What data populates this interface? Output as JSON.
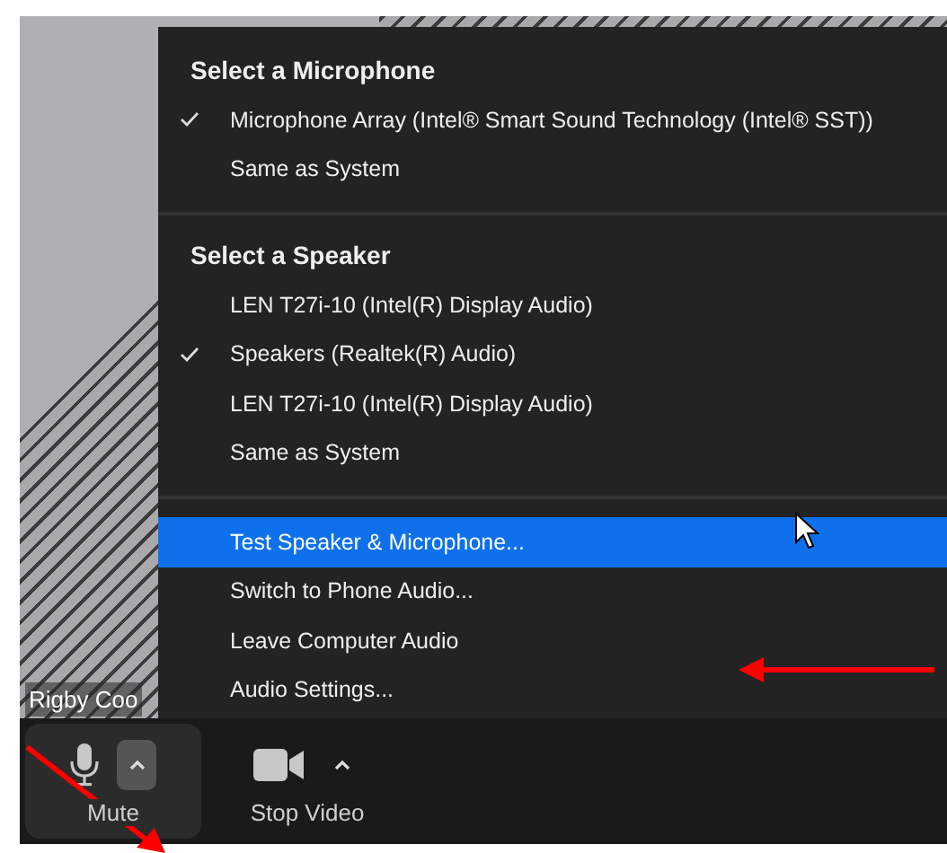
{
  "video": {
    "participant_name": "Rigby Coo"
  },
  "menu": {
    "sections": [
      {
        "heading": "Select a Microphone",
        "items": [
          {
            "label": "Microphone Array (Intel® Smart Sound Technology (Intel® SST))",
            "checked": true
          },
          {
            "label": "Same as System",
            "checked": false
          }
        ]
      },
      {
        "heading": "Select a Speaker",
        "items": [
          {
            "label": "LEN T27i-10 (Intel(R) Display Audio)",
            "checked": false
          },
          {
            "label": "Speakers (Realtek(R) Audio)",
            "checked": true
          },
          {
            "label": "LEN T27i-10 (Intel(R) Display Audio)",
            "checked": false
          },
          {
            "label": "Same as System",
            "checked": false
          }
        ]
      }
    ],
    "actions": [
      {
        "label": "Test Speaker & Microphone...",
        "selected": true
      },
      {
        "label": "Switch to Phone Audio...",
        "selected": false
      },
      {
        "label": "Leave Computer Audio",
        "selected": false
      },
      {
        "label": "Audio Settings...",
        "selected": false
      }
    ]
  },
  "toolbar": [
    {
      "kind": "mic",
      "label": "Mute",
      "highlighted": true
    },
    {
      "kind": "video",
      "label": "Stop Video",
      "highlighted": false
    }
  ]
}
